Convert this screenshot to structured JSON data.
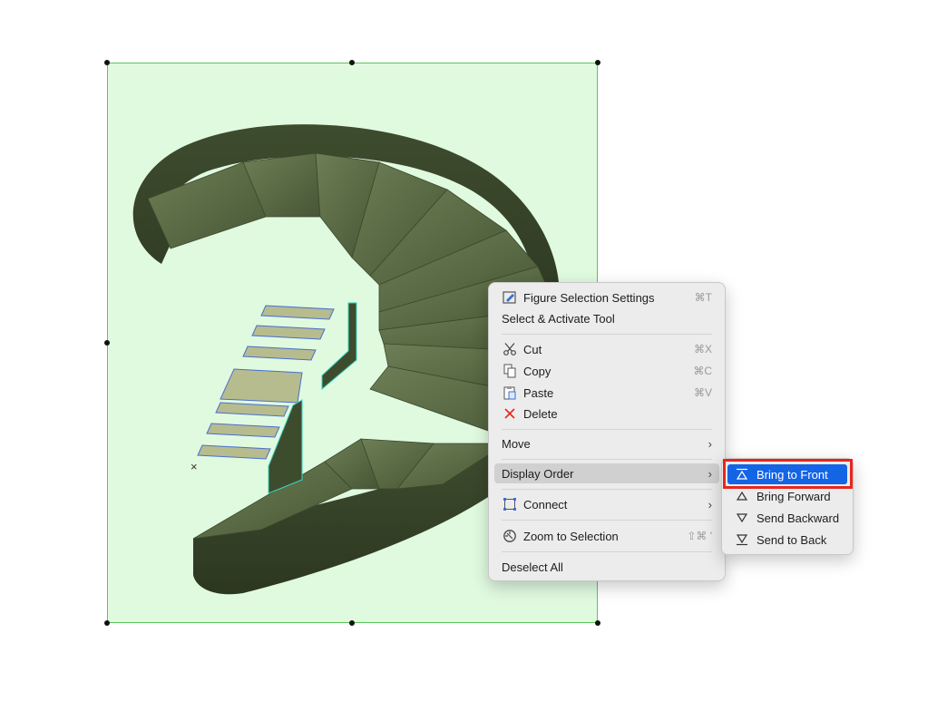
{
  "context_menu": {
    "items": [
      {
        "label": "Figure Selection Settings",
        "shortcut": "⌘T",
        "icon": "figure-settings-icon"
      },
      {
        "label": "Select & Activate Tool"
      },
      {
        "label": "Cut",
        "shortcut": "⌘X",
        "icon": "scissors-icon"
      },
      {
        "label": "Copy",
        "shortcut": "⌘C",
        "icon": "copy-icon"
      },
      {
        "label": "Paste",
        "shortcut": "⌘V",
        "icon": "paste-icon"
      },
      {
        "label": "Delete",
        "icon": "delete-x-icon"
      },
      {
        "label": "Move",
        "submenu_indicator": "›"
      },
      {
        "label": "Display Order",
        "submenu_indicator": "›",
        "highlighted": true
      },
      {
        "label": "Connect",
        "submenu_indicator": "›",
        "icon": "connect-icon"
      },
      {
        "label": "Zoom to Selection",
        "shortcut": "⇧⌘ '",
        "icon": "zoom-selection-icon"
      },
      {
        "label": "Deselect All"
      }
    ]
  },
  "display_order_submenu": {
    "items": [
      {
        "label": "Bring to Front",
        "icon": "bring-to-front-icon",
        "active": true
      },
      {
        "label": "Bring Forward",
        "icon": "bring-forward-icon"
      },
      {
        "label": "Send Backward",
        "icon": "send-backward-icon"
      },
      {
        "label": "Send to Back",
        "icon": "send-to-back-icon"
      }
    ]
  },
  "canvas": {
    "marker": "×"
  },
  "colors": {
    "selection_fill": "#e0fae0",
    "selection_border": "#5ac85a",
    "menu_highlight": "#d0d0d0",
    "submenu_active": "#1464e6",
    "callout_red": "#e8261e",
    "delete_red": "#e8261e",
    "stair_wood": "#5c6f48"
  }
}
